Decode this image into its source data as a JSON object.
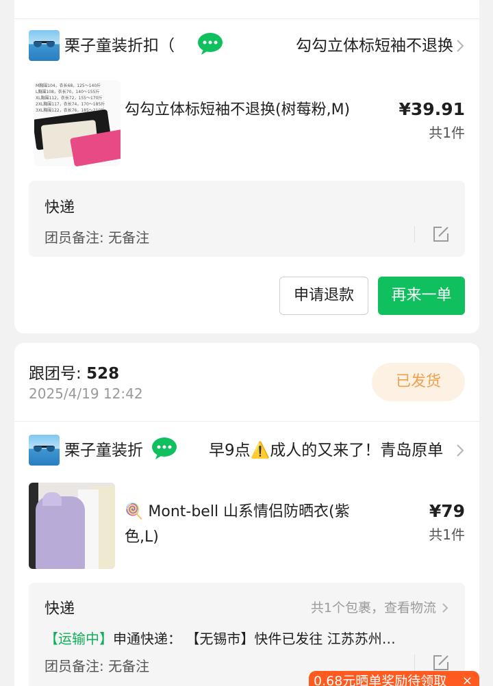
{
  "orders": [
    {
      "shop_name": "栗子童装折扣（",
      "shop_link": "勾勾立体标短袖不退换",
      "item": {
        "title": "勾勾立体标短袖不退换(树莓粉,M)",
        "price": "¥39.91",
        "qty": "共1件",
        "thumb_text_lines": [
          "M胸围104，衣长68，125～140斤",
          "L胸围108，衣长70，140～155斤",
          "XL胸围112，衣长72，155～170斤",
          "2XL胸围117，衣长74，170～185斤",
          "3XL胸围122，衣长76，185～210斤"
        ]
      },
      "delivery": {
        "title": "快递",
        "note": "团员备注: 无备注"
      },
      "buttons": {
        "refund": "申请退款",
        "reorder": "再来一单"
      }
    },
    {
      "order_no_label": "跟团号:",
      "order_no": "528",
      "time": "2025/4/19 12:42",
      "status": "已发货",
      "shop_name": "栗子童装折",
      "shop_link": "早9点⚠️成人的又来了！青岛原单",
      "item": {
        "title": "🍭 Mont-bell 山系情侣防晒衣(紫色,L)",
        "price": "¥79",
        "qty": "共1件"
      },
      "delivery": {
        "title": "快递",
        "track_link": "共1个包裹，查看物流",
        "track_status": "【运输中】",
        "track_detail": "申通快递： 【无锡市】快件已发往 江苏苏州…",
        "note": "团员备注: 无备注"
      }
    }
  ],
  "reward_banner": {
    "text": "0.68元晒单奖励待领取",
    "close": "×"
  },
  "colors": {
    "green": "#10c05e",
    "orange": "#ff5a1f",
    "status_orange": "#f0a04b"
  }
}
